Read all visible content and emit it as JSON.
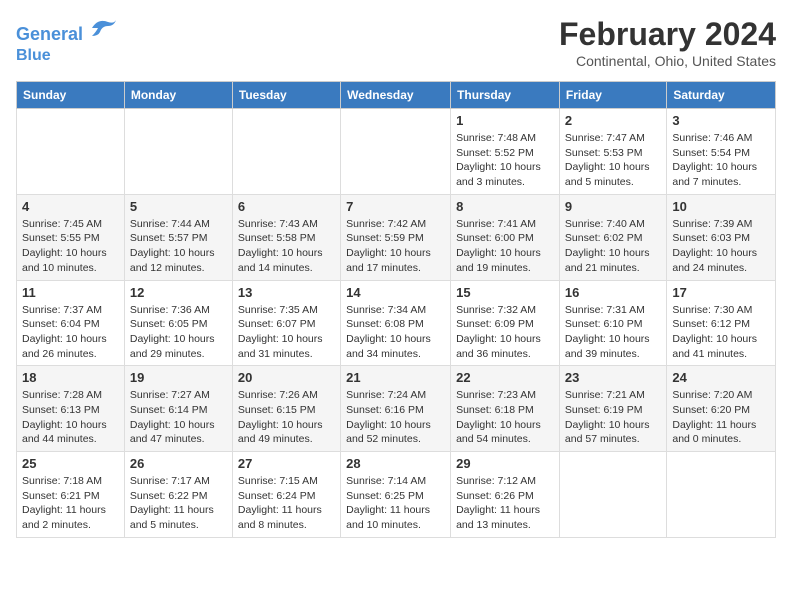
{
  "header": {
    "logo_line1": "General",
    "logo_line2": "Blue",
    "title": "February 2024",
    "subtitle": "Continental, Ohio, United States"
  },
  "columns": [
    "Sunday",
    "Monday",
    "Tuesday",
    "Wednesday",
    "Thursday",
    "Friday",
    "Saturday"
  ],
  "weeks": [
    [
      {
        "day": "",
        "info": ""
      },
      {
        "day": "",
        "info": ""
      },
      {
        "day": "",
        "info": ""
      },
      {
        "day": "",
        "info": ""
      },
      {
        "day": "1",
        "info": "Sunrise: 7:48 AM\nSunset: 5:52 PM\nDaylight: 10 hours and 3 minutes."
      },
      {
        "day": "2",
        "info": "Sunrise: 7:47 AM\nSunset: 5:53 PM\nDaylight: 10 hours and 5 minutes."
      },
      {
        "day": "3",
        "info": "Sunrise: 7:46 AM\nSunset: 5:54 PM\nDaylight: 10 hours and 7 minutes."
      }
    ],
    [
      {
        "day": "4",
        "info": "Sunrise: 7:45 AM\nSunset: 5:55 PM\nDaylight: 10 hours and 10 minutes."
      },
      {
        "day": "5",
        "info": "Sunrise: 7:44 AM\nSunset: 5:57 PM\nDaylight: 10 hours and 12 minutes."
      },
      {
        "day": "6",
        "info": "Sunrise: 7:43 AM\nSunset: 5:58 PM\nDaylight: 10 hours and 14 minutes."
      },
      {
        "day": "7",
        "info": "Sunrise: 7:42 AM\nSunset: 5:59 PM\nDaylight: 10 hours and 17 minutes."
      },
      {
        "day": "8",
        "info": "Sunrise: 7:41 AM\nSunset: 6:00 PM\nDaylight: 10 hours and 19 minutes."
      },
      {
        "day": "9",
        "info": "Sunrise: 7:40 AM\nSunset: 6:02 PM\nDaylight: 10 hours and 21 minutes."
      },
      {
        "day": "10",
        "info": "Sunrise: 7:39 AM\nSunset: 6:03 PM\nDaylight: 10 hours and 24 minutes."
      }
    ],
    [
      {
        "day": "11",
        "info": "Sunrise: 7:37 AM\nSunset: 6:04 PM\nDaylight: 10 hours and 26 minutes."
      },
      {
        "day": "12",
        "info": "Sunrise: 7:36 AM\nSunset: 6:05 PM\nDaylight: 10 hours and 29 minutes."
      },
      {
        "day": "13",
        "info": "Sunrise: 7:35 AM\nSunset: 6:07 PM\nDaylight: 10 hours and 31 minutes."
      },
      {
        "day": "14",
        "info": "Sunrise: 7:34 AM\nSunset: 6:08 PM\nDaylight: 10 hours and 34 minutes."
      },
      {
        "day": "15",
        "info": "Sunrise: 7:32 AM\nSunset: 6:09 PM\nDaylight: 10 hours and 36 minutes."
      },
      {
        "day": "16",
        "info": "Sunrise: 7:31 AM\nSunset: 6:10 PM\nDaylight: 10 hours and 39 minutes."
      },
      {
        "day": "17",
        "info": "Sunrise: 7:30 AM\nSunset: 6:12 PM\nDaylight: 10 hours and 41 minutes."
      }
    ],
    [
      {
        "day": "18",
        "info": "Sunrise: 7:28 AM\nSunset: 6:13 PM\nDaylight: 10 hours and 44 minutes."
      },
      {
        "day": "19",
        "info": "Sunrise: 7:27 AM\nSunset: 6:14 PM\nDaylight: 10 hours and 47 minutes."
      },
      {
        "day": "20",
        "info": "Sunrise: 7:26 AM\nSunset: 6:15 PM\nDaylight: 10 hours and 49 minutes."
      },
      {
        "day": "21",
        "info": "Sunrise: 7:24 AM\nSunset: 6:16 PM\nDaylight: 10 hours and 52 minutes."
      },
      {
        "day": "22",
        "info": "Sunrise: 7:23 AM\nSunset: 6:18 PM\nDaylight: 10 hours and 54 minutes."
      },
      {
        "day": "23",
        "info": "Sunrise: 7:21 AM\nSunset: 6:19 PM\nDaylight: 10 hours and 57 minutes."
      },
      {
        "day": "24",
        "info": "Sunrise: 7:20 AM\nSunset: 6:20 PM\nDaylight: 11 hours and 0 minutes."
      }
    ],
    [
      {
        "day": "25",
        "info": "Sunrise: 7:18 AM\nSunset: 6:21 PM\nDaylight: 11 hours and 2 minutes."
      },
      {
        "day": "26",
        "info": "Sunrise: 7:17 AM\nSunset: 6:22 PM\nDaylight: 11 hours and 5 minutes."
      },
      {
        "day": "27",
        "info": "Sunrise: 7:15 AM\nSunset: 6:24 PM\nDaylight: 11 hours and 8 minutes."
      },
      {
        "day": "28",
        "info": "Sunrise: 7:14 AM\nSunset: 6:25 PM\nDaylight: 11 hours and 10 minutes."
      },
      {
        "day": "29",
        "info": "Sunrise: 7:12 AM\nSunset: 6:26 PM\nDaylight: 11 hours and 13 minutes."
      },
      {
        "day": "",
        "info": ""
      },
      {
        "day": "",
        "info": ""
      }
    ]
  ]
}
